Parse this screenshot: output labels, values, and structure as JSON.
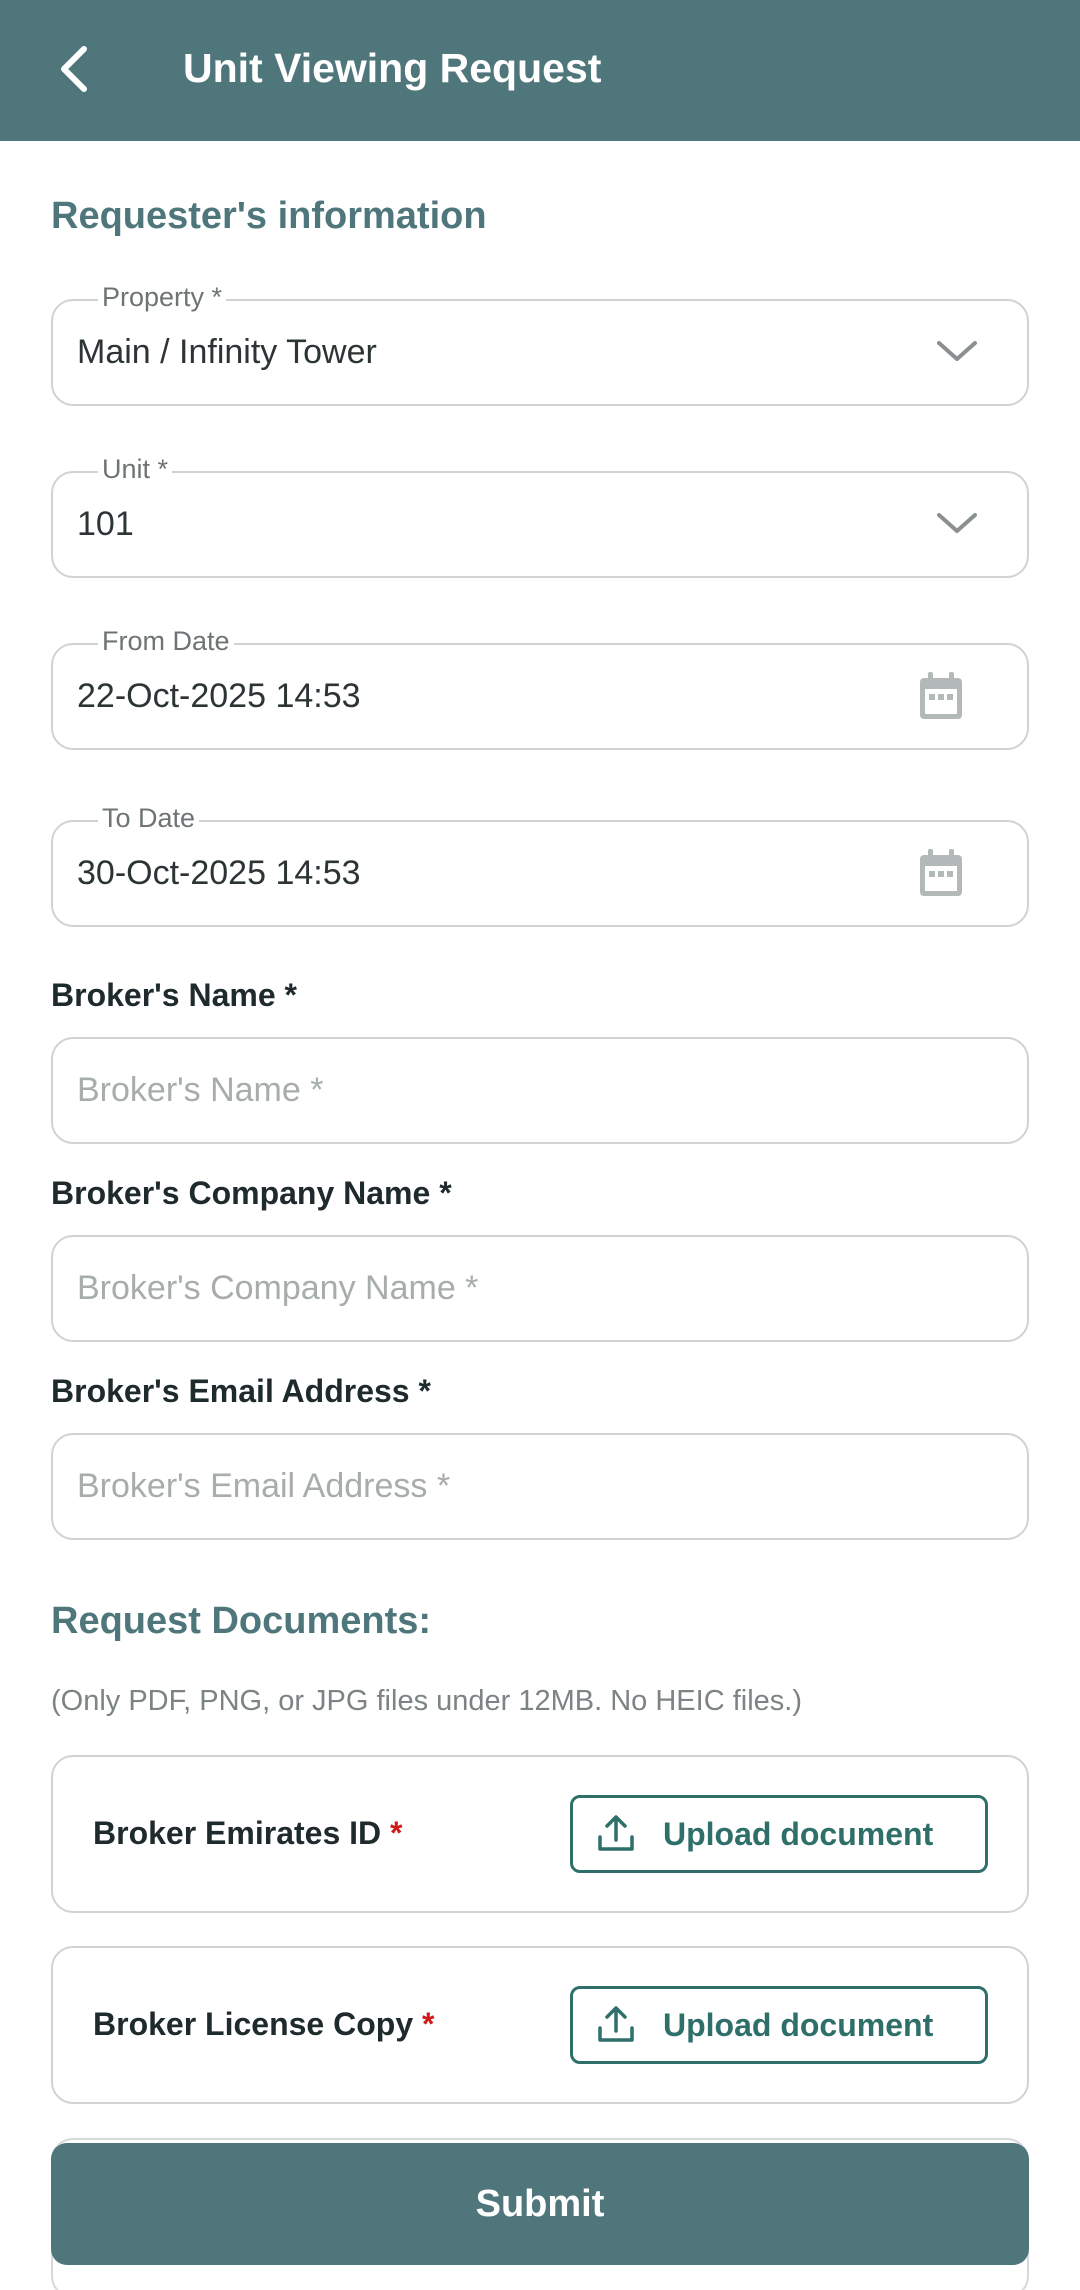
{
  "header": {
    "back_icon": "chevron-left-icon",
    "title": "Unit Viewing Request"
  },
  "requester_section": {
    "title": "Requester's information"
  },
  "fields": {
    "property": {
      "label": "Property *",
      "value": "Main / Infinity Tower",
      "icon": "chevron-down-icon"
    },
    "unit": {
      "label": "Unit *",
      "value": "101",
      "icon": "chevron-down-icon"
    },
    "from_date": {
      "label": "From Date",
      "value": "22-Oct-2025 14:53",
      "icon": "calendar-icon"
    },
    "to_date": {
      "label": "To Date",
      "value": "30-Oct-2025 14:53",
      "icon": "calendar-icon"
    }
  },
  "broker": {
    "name": {
      "label": "Broker's Name *",
      "placeholder": "Broker's Name *",
      "value": ""
    },
    "company": {
      "label": "Broker's Company Name *",
      "placeholder": "Broker's Company Name *",
      "value": ""
    },
    "email": {
      "label": "Broker's Email Address *",
      "placeholder": "Broker's Email Address *",
      "value": ""
    }
  },
  "documents": {
    "title": "Request Documents:",
    "note": "(Only PDF, PNG, or JPG files under 12MB. No HEIC files.)",
    "items": [
      {
        "label": "Broker Emirates ID",
        "required_mark": "*",
        "button": "Upload document",
        "icon": "upload-icon"
      },
      {
        "label": "Broker License Copy",
        "required_mark": "*",
        "button": "Upload document",
        "icon": "upload-icon"
      }
    ]
  },
  "submit": {
    "label": "Submit"
  },
  "colors": {
    "primary": "#4f777b",
    "accent": "#2f6f6a",
    "required": "#d11a1a",
    "border": "#cfd3d3"
  }
}
